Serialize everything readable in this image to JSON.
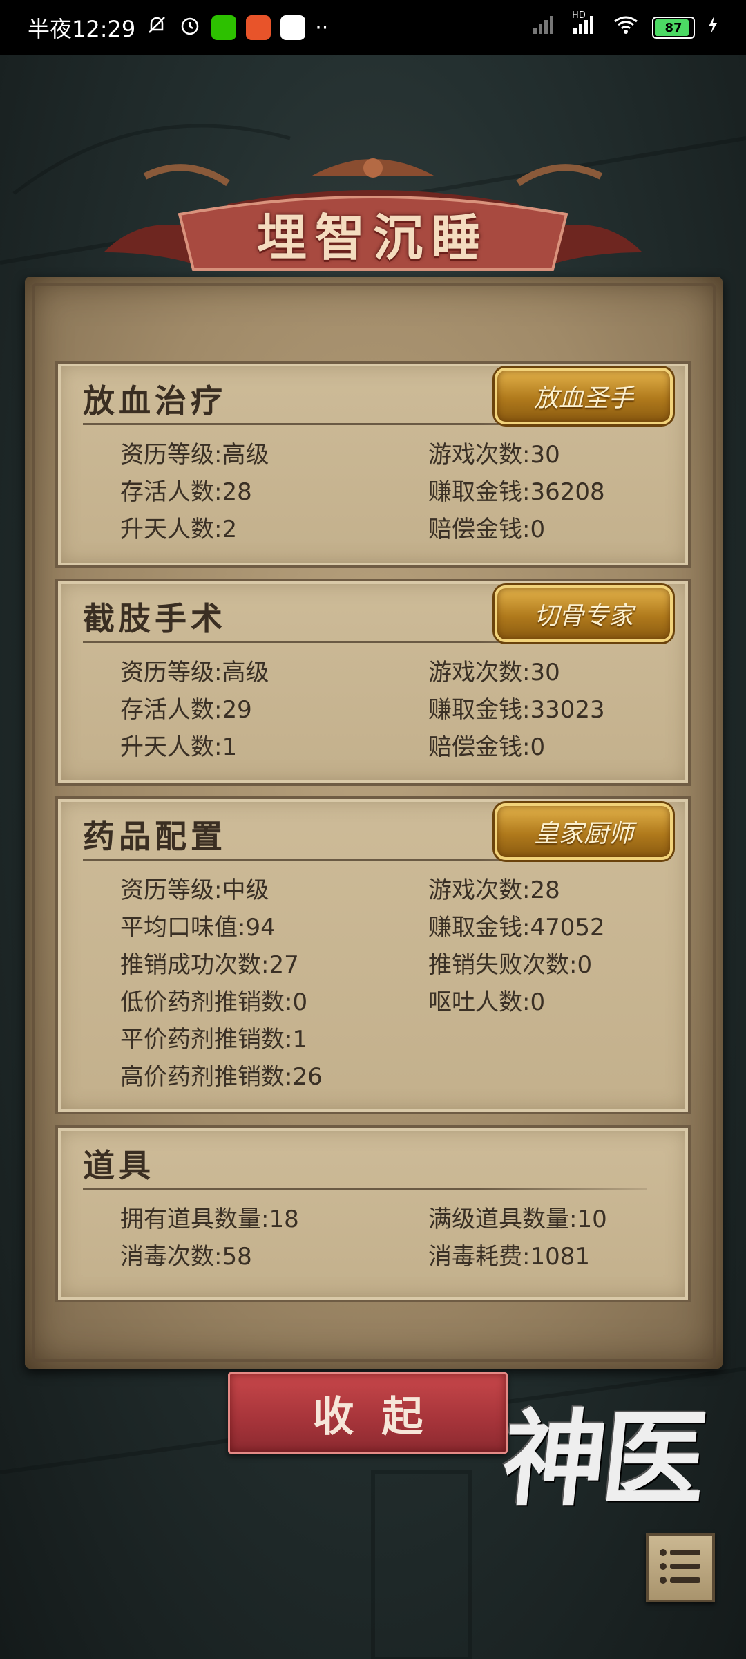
{
  "status_bar": {
    "time": "半夜12:29",
    "battery": "87",
    "network_label": "HD"
  },
  "title": "埋智沉睡",
  "sections": [
    {
      "header": "放血治疗",
      "badge": "放血圣手",
      "stats": [
        {
          "label": "资历等级:",
          "value": "高级"
        },
        {
          "label": "游戏次数:",
          "value": "30"
        },
        {
          "label": "存活人数:",
          "value": "28"
        },
        {
          "label": "赚取金钱:",
          "value": "36208"
        },
        {
          "label": "升天人数:",
          "value": "2"
        },
        {
          "label": "赔偿金钱:",
          "value": "0"
        }
      ]
    },
    {
      "header": "截肢手术",
      "badge": "切骨专家",
      "stats": [
        {
          "label": "资历等级:",
          "value": "高级"
        },
        {
          "label": "游戏次数:",
          "value": "30"
        },
        {
          "label": "存活人数:",
          "value": "29"
        },
        {
          "label": "赚取金钱:",
          "value": "33023"
        },
        {
          "label": "升天人数:",
          "value": "1"
        },
        {
          "label": "赔偿金钱:",
          "value": "0"
        }
      ]
    },
    {
      "header": "药品配置",
      "badge": "皇家厨师",
      "stats": [
        {
          "label": "资历等级:",
          "value": "中级"
        },
        {
          "label": "游戏次数:",
          "value": "28"
        },
        {
          "label": "平均口味值:",
          "value": "94"
        },
        {
          "label": "赚取金钱:",
          "value": "47052"
        },
        {
          "label": "推销成功次数:",
          "value": "27"
        },
        {
          "label": "推销失败次数:",
          "value": "0"
        },
        {
          "label": "低价药剂推销数:",
          "value": "0"
        },
        {
          "label": "呕吐人数:",
          "value": "0"
        },
        {
          "label": "平价药剂推销数:",
          "value": "1"
        },
        {
          "label": "",
          "value": ""
        },
        {
          "label": "高价药剂推销数:",
          "value": "26"
        },
        {
          "label": "",
          "value": ""
        }
      ]
    },
    {
      "header": "道具",
      "stats": [
        {
          "label": "拥有道具数量:",
          "value": "18"
        },
        {
          "label": "满级道具数量:",
          "value": "10"
        },
        {
          "label": "消毒次数:",
          "value": "58"
        },
        {
          "label": "消毒耗费:",
          "value": "1081"
        }
      ]
    }
  ],
  "collapse_button": "收起",
  "logo_text": "神医",
  "colors": {
    "accent_red": "#a6343a",
    "badge_gold": "#c48a26",
    "parchment": "#c3b08c"
  }
}
